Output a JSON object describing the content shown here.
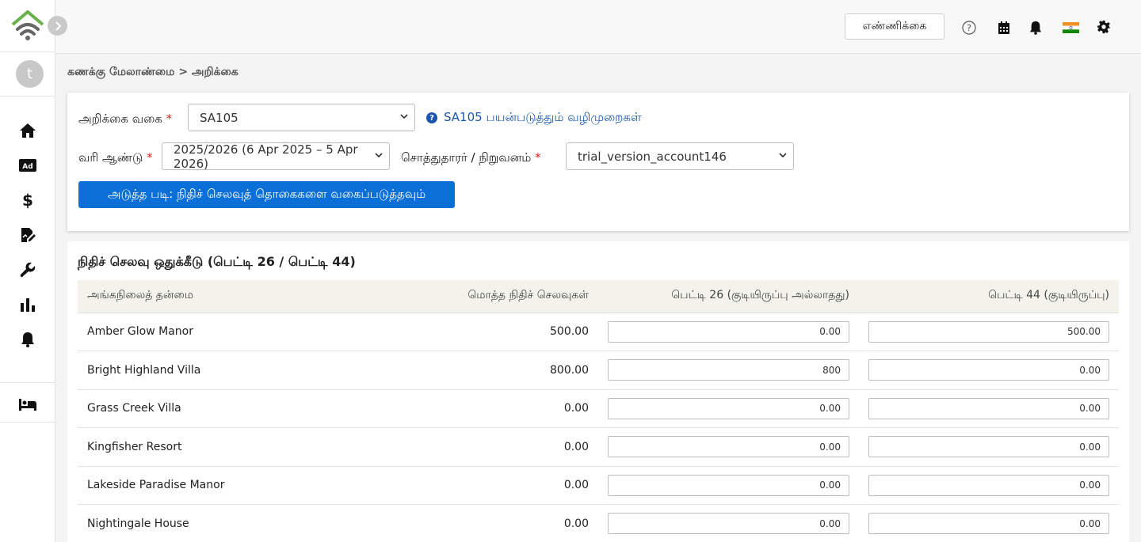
{
  "topbar": {
    "count_button": "எண்ணிக்கை"
  },
  "sidebar": {
    "avatar_initial": "t",
    "items": [
      {
        "icon": "home-icon"
      },
      {
        "icon": "ad-icon",
        "label": "Ad"
      },
      {
        "icon": "dollar-icon",
        "label": "$"
      },
      {
        "icon": "document-edit-icon"
      },
      {
        "icon": "wrench-icon"
      },
      {
        "icon": "bar-chart-icon"
      },
      {
        "icon": "bell-icon"
      },
      {
        "icon": "bed-icon"
      }
    ]
  },
  "breadcrumb": {
    "parent": "கணக்கு மேலாண்மை",
    "separator": ">",
    "current": "அறிக்கை"
  },
  "form": {
    "report_type_label": "அறிக்கை வகை",
    "report_type_value": "SA105",
    "help_link": "SA105 பயன்படுத்தும் வழிமுறைகள்",
    "tax_year_label": "வரி ஆண்டு",
    "tax_year_value": "2025/2026 (6 Apr 2025 – 5 Apr 2026)",
    "owner_label": "சொத்துதாரர் / நிறுவனம்",
    "owner_value": "trial_version_account146",
    "next_button": "அடுத்த படி: நிதிச் செலவுத் தொகைகளை வகைப்படுத்தவும்",
    "required_mark": "*"
  },
  "table": {
    "title": "நிதிச் செலவு ஒதுக்கீடு (பெட்டி 26 / பெட்டி 44)",
    "headers": [
      "அங்கநிலைத் தன்மை",
      "மொத்த நிதிச் செலவுகள்",
      "பெட்டி 26 (குடியிருப்பு அல்லாதது)",
      "பெட்டி 44 (குடியிருப்பு)"
    ],
    "rows": [
      {
        "name": "Amber Glow Manor",
        "total": "500.00",
        "box26": "0.00",
        "box44": "500.00"
      },
      {
        "name": "Bright Highland Villa",
        "total": "800.00",
        "box26": "800",
        "box44": "0.00"
      },
      {
        "name": "Grass Creek Villa",
        "total": "0.00",
        "box26": "0.00",
        "box44": "0.00"
      },
      {
        "name": "Kingfisher Resort",
        "total": "0.00",
        "box26": "0.00",
        "box44": "0.00"
      },
      {
        "name": "Lakeside Paradise Manor",
        "total": "0.00",
        "box26": "0.00",
        "box44": "0.00"
      },
      {
        "name": "Nightingale House",
        "total": "0.00",
        "box26": "0.00",
        "box44": "0.00"
      }
    ]
  },
  "colors": {
    "primary": "#0a6fd6",
    "logo_green": "#6ab04c",
    "logo_gray": "#555555"
  }
}
